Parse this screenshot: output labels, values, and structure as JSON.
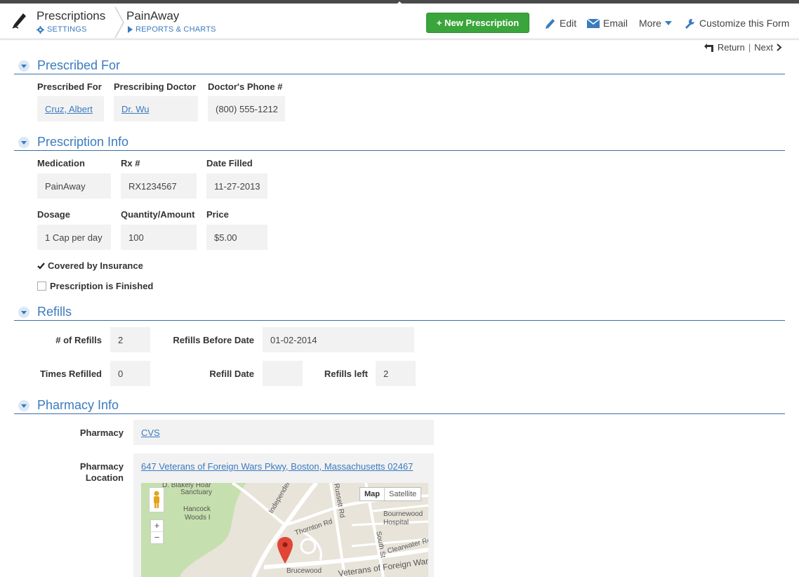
{
  "header": {
    "app_title": "Prescriptions",
    "settings_label": "SETTINGS",
    "record_title": "PainAway",
    "reports_label": "REPORTS & CHARTS",
    "new_button": "+ New Prescription",
    "edit_label": "Edit",
    "email_label": "Email",
    "more_label": "More",
    "customize_label": "Customize this Form"
  },
  "nav": {
    "return_label": "Return",
    "separator": "|",
    "next_label": "Next"
  },
  "sections": {
    "prescribed_for": {
      "title": "Prescribed For",
      "fields": [
        {
          "label": "Prescribed For",
          "value": "Cruz, Albert"
        },
        {
          "label": "Prescribing Doctor",
          "value": "Dr. Wu"
        },
        {
          "label": "Doctor's Phone #",
          "value": "(800) 555-1212"
        }
      ]
    },
    "prescription_info": {
      "title": "Prescription Info",
      "fields": [
        {
          "label": "Medication",
          "value": "PainAway"
        },
        {
          "label": "Rx #",
          "value": "RX1234567"
        },
        {
          "label": "Date Filled",
          "value": "11-27-2013"
        },
        {
          "label": "Dosage",
          "value": "1 Cap per day"
        },
        {
          "label": "Quantity/Amount",
          "value": "100"
        },
        {
          "label": "Price",
          "value": "$5.00"
        }
      ],
      "covered_by_insurance": {
        "label": "Covered by Insurance",
        "checked": true
      },
      "prescription_finished": {
        "label": "Prescription is Finished",
        "checked": false
      }
    },
    "refills": {
      "title": "Refills",
      "fields": [
        {
          "label": "# of Refills",
          "value": "2"
        },
        {
          "label": "Refills Before Date",
          "value": "01-02-2014"
        },
        {
          "label": "Times Refilled",
          "value": "0"
        },
        {
          "label": "Refill Date",
          "value": ""
        },
        {
          "label": "Refills left",
          "value": "2"
        }
      ]
    },
    "pharmacy_info": {
      "title": "Pharmacy Info",
      "pharmacy_label": "Pharmacy",
      "pharmacy_value": "CVS",
      "location_label_1": "Pharmacy",
      "location_label_2": "Location",
      "location_value": "647 Veterans of Foreign Wars Pkwy, Boston, Massachusetts 02467",
      "map": {
        "map_button": "Map",
        "satellite_button": "Satellite",
        "zoom_in": "+",
        "zoom_out": "−",
        "labels": [
          "D. Blakely Hoar",
          "Sanctuary",
          "Hancock",
          "Woods I",
          "Independence Dr",
          "Thornton Rd",
          "Russett Rd",
          "Bournewood",
          "Hospital",
          "South St",
          "Clearwater Rd",
          "Brucewood",
          "Veterans of Foreign Wars P"
        ]
      }
    }
  },
  "colors": {
    "accent": "#3b7bbf",
    "primary_button": "#3aa53a",
    "field_bg": "#f2f2f2"
  }
}
